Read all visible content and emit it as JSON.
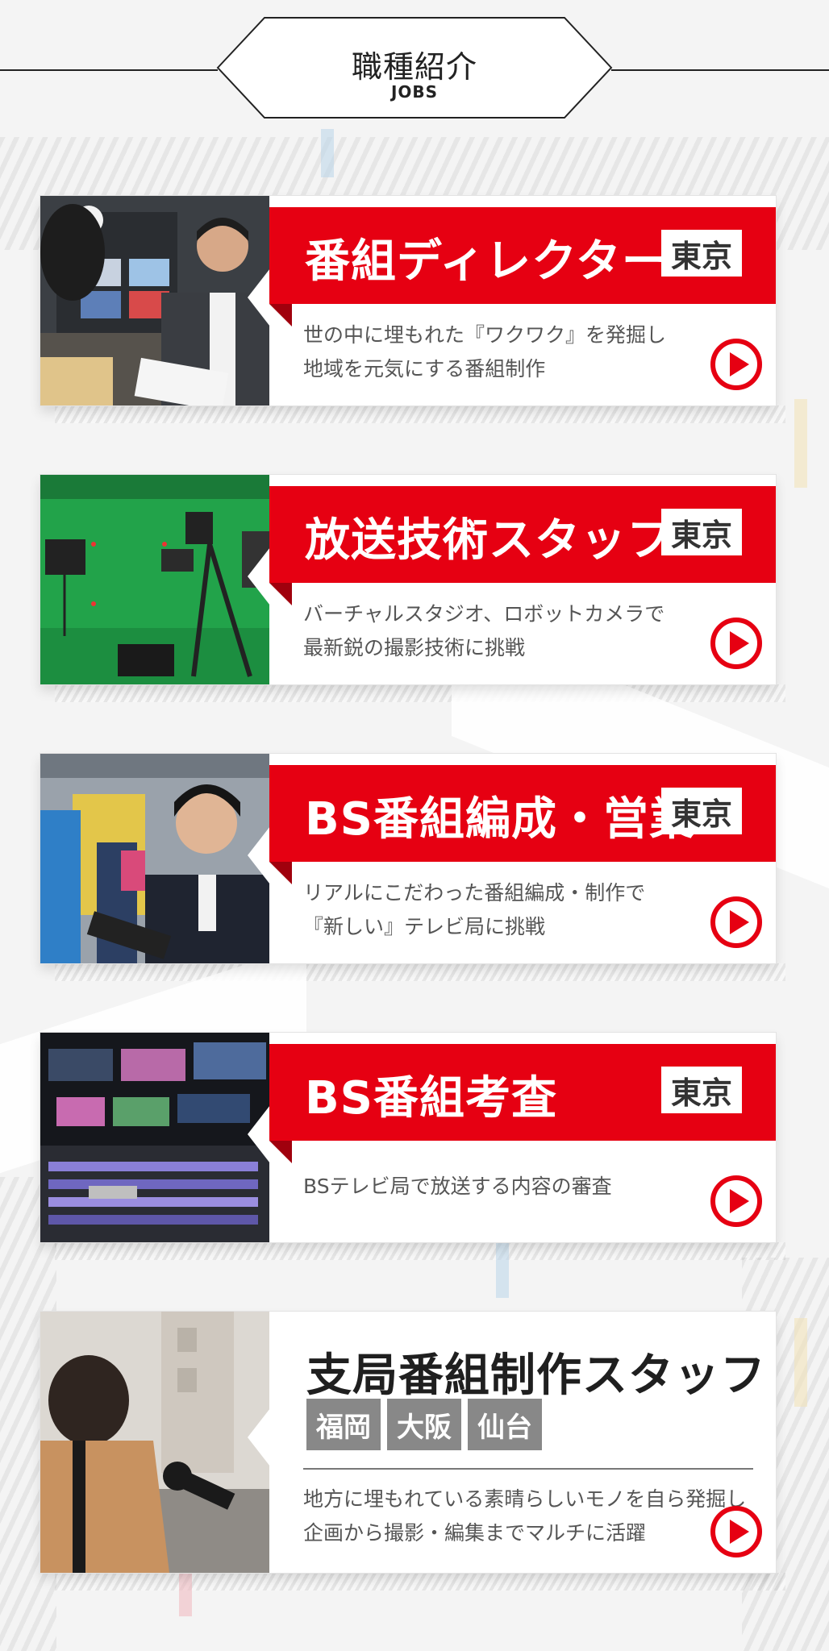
{
  "heading": {
    "title_jp": "職種紹介",
    "title_en": "JOBS"
  },
  "colors": {
    "accent": "#e60012",
    "badge_gray": "#888888"
  },
  "jobs": [
    {
      "title": "番組ディレクター",
      "location": "東京",
      "desc1": "世の中に埋もれた『ワクワク』を発掘し",
      "desc2": "地域を元気にする番組制作",
      "photo": "director-in-control-room"
    },
    {
      "title": "放送技術スタッフ",
      "location": "東京",
      "desc1": "バーチャルスタジオ、ロボットカメラで",
      "desc2": "最新鋭の撮影技術に挑戦",
      "photo": "green-screen-studio"
    },
    {
      "title": "BS番組編成・営業",
      "location": "東京",
      "desc1": "リアルにこだわった番組編成・制作で",
      "desc2": "『新しい』テレビ局に挑戦",
      "photo": "staff-taking-notes"
    },
    {
      "title": "BS番組考査",
      "location": "東京",
      "desc1": "BSテレビ局で放送する内容の審査",
      "photo": "broadcast-switcher"
    },
    {
      "title": "支局番組制作スタッフ",
      "locations": [
        "福岡",
        "大阪",
        "仙台"
      ],
      "desc1": "地方に埋もれている素晴らしいモノを自ら発掘し",
      "desc2": "企画から撮影・編集までマルチに活躍",
      "photo": "street-interview"
    }
  ]
}
